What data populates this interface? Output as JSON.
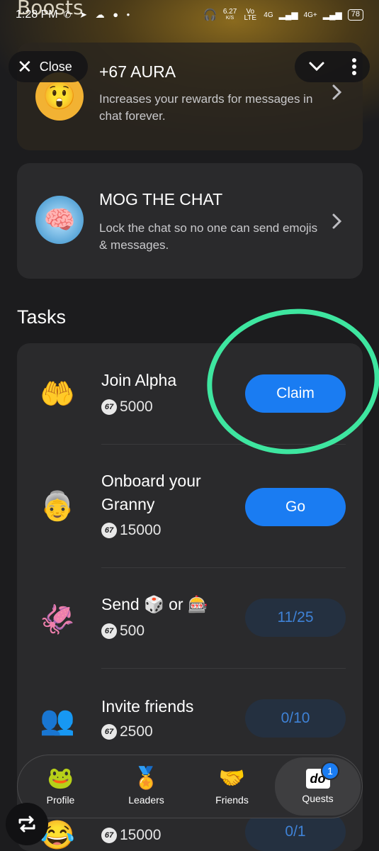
{
  "header": {
    "title": "Boosts",
    "close_label": "Close"
  },
  "status_bar": {
    "time": "1:28 PM",
    "speed_value": "6.27",
    "speed_unit": "K/S",
    "network_1": "Vo LTE",
    "network_2": "4G",
    "network_3": "4G+",
    "battery": "78"
  },
  "boosts": [
    {
      "title": "+67 AURA",
      "description": "Increases your rewards for messages in chat forever.",
      "icon": "shocked-face-emoji"
    },
    {
      "title": "MOG THE CHAT",
      "description": "Lock the chat so no one can send emojis & messages.",
      "icon": "frozen-brain-emoji"
    }
  ],
  "tasks_heading": "Tasks",
  "tasks": [
    {
      "title": "Join Alpha",
      "reward": "5000",
      "button": "Claim",
      "button_style": "primary",
      "icon": "67-hands-emoji"
    },
    {
      "title": "Onboard your Granny",
      "reward": "15000",
      "button": "Go",
      "button_style": "primary",
      "icon": "granny-emoji"
    },
    {
      "title_prefix": "Send",
      "title_middle": "or",
      "reward": "500",
      "button": "11/25",
      "button_style": "disabled",
      "icon": "laptop-squid-emoji"
    },
    {
      "title": "Invite friends",
      "reward": "2500",
      "button": "0/10",
      "button_style": "disabled",
      "icon": "friends-emoji"
    },
    {
      "reward": "15000",
      "button": "0/1",
      "button_style": "disabled",
      "icon": "laughing-emoji"
    }
  ],
  "nav": {
    "items": [
      {
        "label": "Profile",
        "icon": "frog-crown-icon"
      },
      {
        "label": "Leaders",
        "icon": "67-chain-icon"
      },
      {
        "label": "Friends",
        "icon": "handshake-icon"
      },
      {
        "label": "Quests",
        "icon": "do-key-icon",
        "badge": "1"
      }
    ],
    "active": "Quests"
  },
  "colors": {
    "background": "#1c1c1e",
    "card": "#2a2a2c",
    "accent": "#1a7cf2",
    "highlight": "#3ee6a0"
  }
}
